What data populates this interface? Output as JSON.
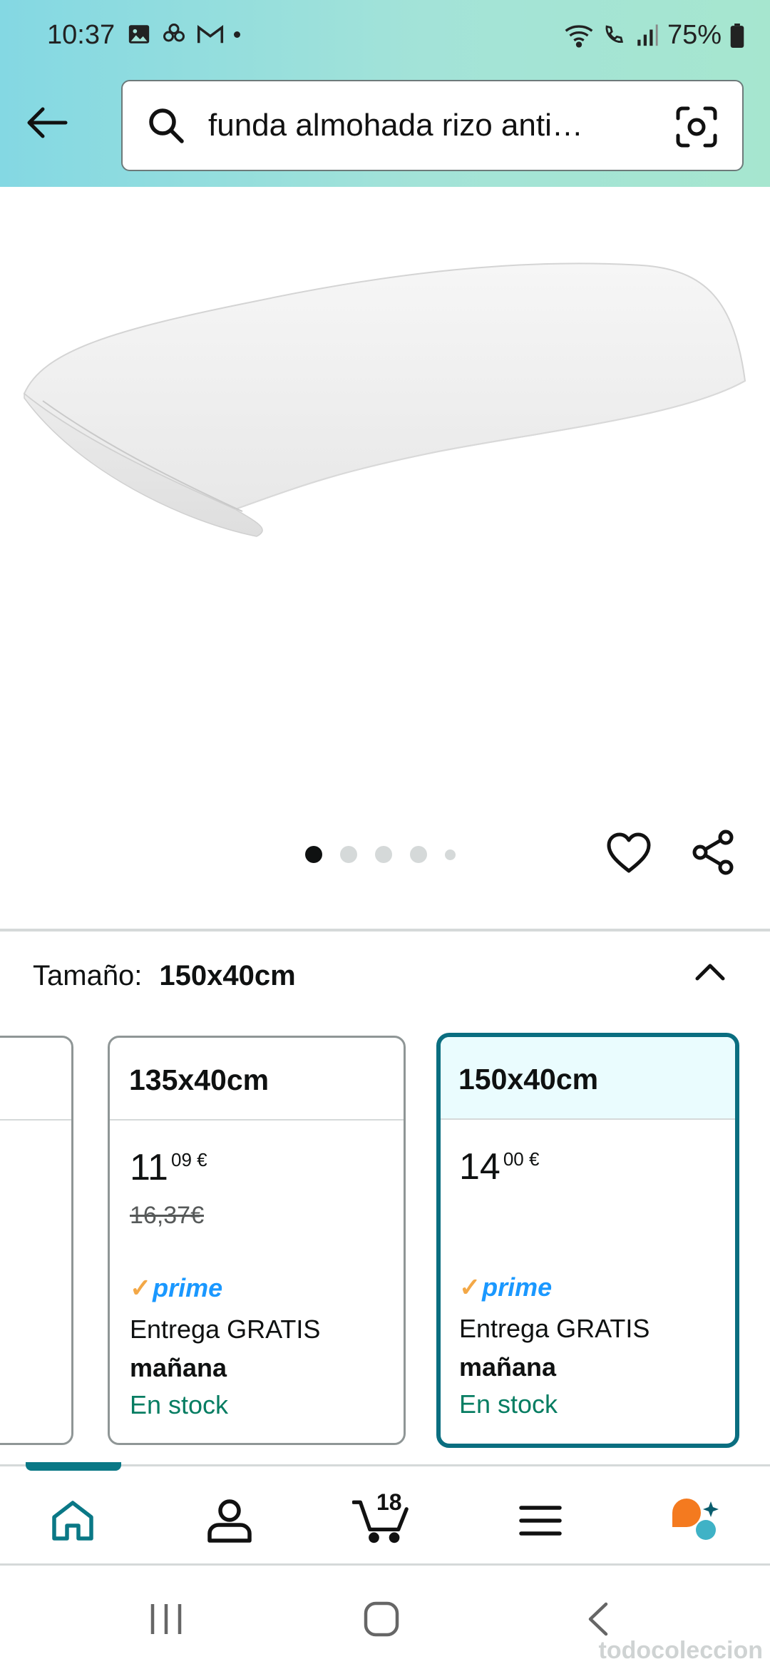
{
  "status_bar": {
    "time": "10:37",
    "battery": "75%",
    "left_icons": [
      "gallery-icon",
      "flower-icon",
      "gmail-icon",
      "dot"
    ],
    "right_icons": [
      "wifi-icon",
      "wifi-call-icon",
      "signal-icon",
      "battery-icon"
    ]
  },
  "search": {
    "query": "funda almohada rizo anti…"
  },
  "carousel": {
    "total_dots": 5,
    "active_index": 0
  },
  "size_selector": {
    "label": "Tamaño:",
    "selected": "150x40cm"
  },
  "size_options": [
    {
      "size": "135x40cm",
      "price_whole": "11",
      "price_fraction": "09",
      "currency": "€",
      "old_price": "16,37€",
      "prime": "prime",
      "delivery": "Entrega GRATIS",
      "delivery_day": "mañana",
      "stock": "En stock"
    },
    {
      "size": "150x40cm",
      "price_whole": "14",
      "price_fraction": "00",
      "currency": "€",
      "prime": "prime",
      "delivery": "Entrega GRATIS",
      "delivery_day": "mañana",
      "stock": "En stock",
      "selected": true
    }
  ],
  "bottom_nav": {
    "items": [
      "home-icon",
      "account-icon",
      "cart-icon",
      "menu-icon",
      "rufus-ai-icon"
    ],
    "cart_count": "18",
    "active": "home"
  },
  "watermark": "todocoleccion",
  "colors": {
    "header_gradient_start": "#84d8e3",
    "header_gradient_end": "#a6e6cf",
    "selected_border": "#0a6e80",
    "prime_blue": "#1a98ff",
    "prime_check": "#f3a847",
    "in_stock": "#067d62"
  }
}
